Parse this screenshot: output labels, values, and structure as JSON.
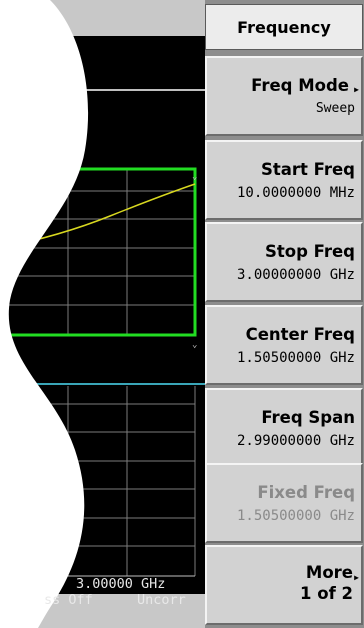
{
  "menu": {
    "title": "Frequency",
    "softkeys": [
      {
        "label": "Freq Mode",
        "value": "Sweep",
        "submenu": true,
        "enabled": true
      },
      {
        "label": "Start Freq",
        "value": "10.0000000 MHz",
        "submenu": false,
        "enabled": true
      },
      {
        "label": "Stop Freq",
        "value": "3.00000000 GHz",
        "submenu": false,
        "enabled": true
      },
      {
        "label": "Center Freq",
        "value": "1.50500000 GHz",
        "submenu": false,
        "enabled": true
      },
      {
        "label": "Freq Span",
        "value": "2.99000000 GHz",
        "submenu": false,
        "enabled": true
      },
      {
        "label": "Fixed Freq",
        "value": "1.50500000 GHz",
        "submenu": false,
        "enabled": false
      },
      {
        "label": "More",
        "value": "1 of 2",
        "submenu": true,
        "enabled": true
      }
    ]
  },
  "display": {
    "stop_freq_readout": "3.00000 GHz",
    "status_partial": "ss Off",
    "correction": "Uncorr"
  },
  "colors": {
    "active_box": "#22dd22",
    "trace": "#d8d820",
    "divider": "#3aa6b8",
    "grid": "#8a8a8a"
  },
  "icons": {
    "submenu": "triangle-right-icon",
    "marker": "chevron-down-icon"
  }
}
